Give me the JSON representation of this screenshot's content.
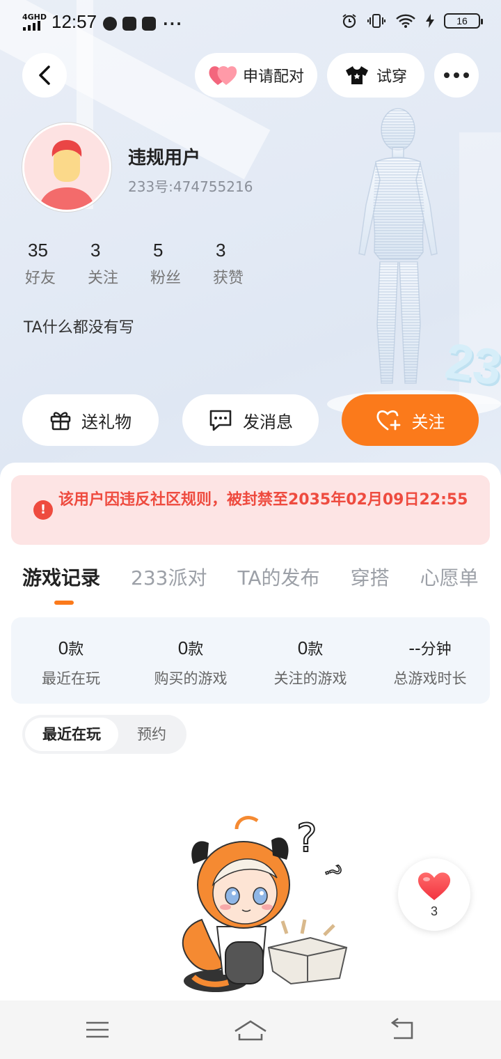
{
  "status_bar": {
    "network": "4GHD",
    "time": "12:57",
    "more": "···",
    "battery": "16"
  },
  "header": {
    "pair_label": "申请配对",
    "try_on_label": "试穿"
  },
  "profile": {
    "name": "违规用户",
    "uid": "233号:474755216",
    "stats": [
      {
        "value": "35",
        "label": "好友"
      },
      {
        "value": "3",
        "label": "关注"
      },
      {
        "value": "5",
        "label": "粉丝"
      },
      {
        "value": "3",
        "label": "获赞"
      }
    ],
    "bio": "TA什么都没有写"
  },
  "actions": {
    "gift_label": "送礼物",
    "message_label": "发消息",
    "follow_label": "关注"
  },
  "ban_notice": "该用户因违反社区规则，被封禁至2035年02月09日22:55",
  "tabs": [
    "游戏记录",
    "233派对",
    "TA的发布",
    "穿搭",
    "心愿单"
  ],
  "game_stats": [
    {
      "value": "0",
      "unit": "款",
      "label": "最近在玩"
    },
    {
      "value": "0",
      "unit": "款",
      "label": "购买的游戏"
    },
    {
      "value": "0",
      "unit": "款",
      "label": "关注的游戏"
    },
    {
      "value": "--",
      "unit": "分钟",
      "label": "总游戏时长"
    }
  ],
  "subtabs": [
    "最近在玩",
    "预约"
  ],
  "likes_count": "3",
  "colors": {
    "accent": "#fb7a1b",
    "ban_text": "#ee4b3f",
    "ban_bg": "#fde4e4"
  },
  "icons": [
    "back-icon",
    "heart-icon",
    "tshirt-icon",
    "more-icon",
    "gift-icon",
    "message-icon",
    "heart-plus-icon",
    "alert-icon",
    "menu-icon",
    "home-icon",
    "return-icon"
  ]
}
